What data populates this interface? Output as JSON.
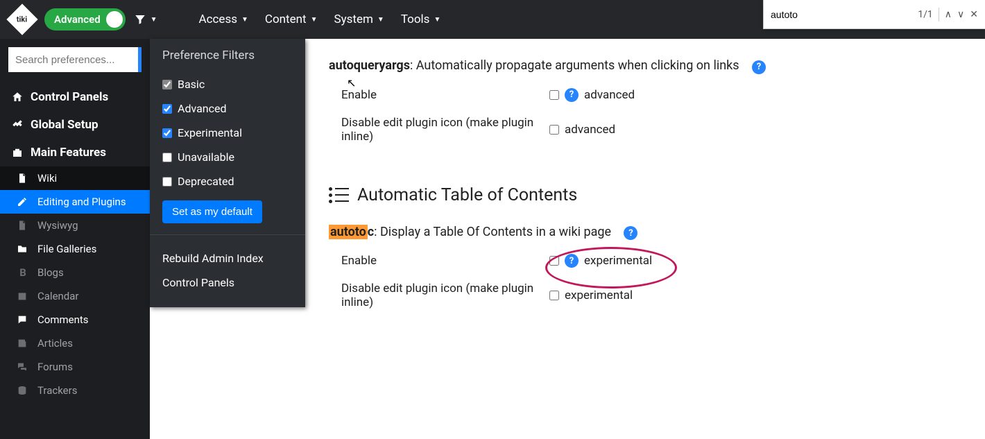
{
  "topbar": {
    "logo_text": "tiki",
    "advanced_label": "Advanced",
    "nav": [
      {
        "label": "Access"
      },
      {
        "label": "Content"
      },
      {
        "label": "System"
      },
      {
        "label": "Tools"
      }
    ]
  },
  "findbar": {
    "query": "autoto",
    "count": "1/1"
  },
  "sidebar": {
    "search_placeholder": "Search preferences...",
    "sections": {
      "control_panels": "Control Panels",
      "global_setup": "Global Setup",
      "main_features": "Main Features"
    },
    "items": [
      {
        "label": "Wiki",
        "icon": "file"
      },
      {
        "label": "Editing and Plugins",
        "icon": "edit"
      },
      {
        "label": "Wysiwyg",
        "icon": "file"
      },
      {
        "label": "File Galleries",
        "icon": "folder"
      },
      {
        "label": "Blogs",
        "icon": "bold"
      },
      {
        "label": "Calendar",
        "icon": "calendar"
      },
      {
        "label": "Comments",
        "icon": "comment"
      },
      {
        "label": "Articles",
        "icon": "news"
      },
      {
        "label": "Forums",
        "icon": "chat"
      },
      {
        "label": "Trackers",
        "icon": "db"
      }
    ]
  },
  "filter_panel": {
    "title": "Preference Filters",
    "options": {
      "basic": "Basic",
      "advanced": "Advanced",
      "experimental": "Experimental",
      "unavailable": "Unavailable",
      "deprecated": "Deprecated"
    },
    "default_btn": "Set as my default",
    "links": {
      "rebuild": "Rebuild Admin Index",
      "control_panels": "Control Panels"
    }
  },
  "main": {
    "autoqueryargs": {
      "name": "autoqueryargs",
      "desc": ": Automatically propagate arguments when clicking on links",
      "rows": [
        {
          "label": "Enable",
          "tag": "advanced",
          "help": true
        },
        {
          "label": "Disable edit plugin icon (make plugin inline)",
          "tag": "advanced",
          "help": false
        }
      ]
    },
    "section_title": "Automatic Table of Contents",
    "autotoc": {
      "name_hl": "autoto",
      "name_rest": "c",
      "desc": ": Display a Table Of Contents in a wiki page",
      "rows": [
        {
          "label": "Enable",
          "tag": "experimental",
          "help": true
        },
        {
          "label": "Disable edit plugin icon (make plugin inline)",
          "tag": "experimental",
          "help": false
        }
      ]
    }
  }
}
